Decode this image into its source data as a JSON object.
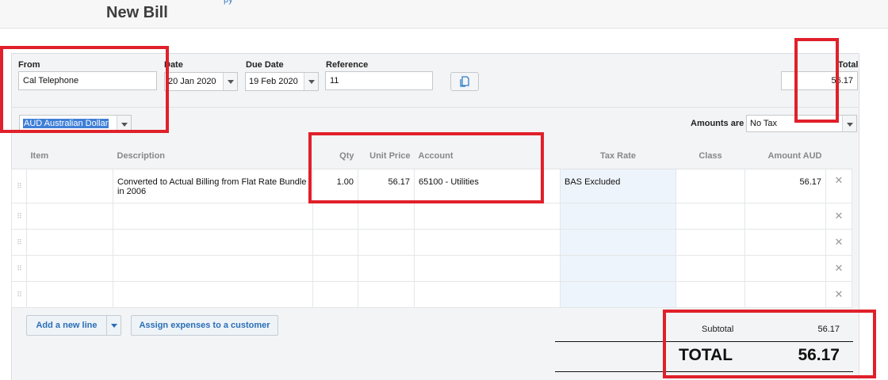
{
  "header": {
    "title": "New Bill",
    "top_link": "py"
  },
  "form": {
    "from_label": "From",
    "from_value": "Cal Telephone",
    "date_label": "Date",
    "date_value": "20 Jan 2020",
    "due_label": "Due Date",
    "due_value": "19 Feb 2020",
    "reference_label": "Reference",
    "reference_value": "11",
    "total_label": "Total",
    "total_value": "56.17",
    "currency_value": "AUD Australian Dollar",
    "amounts_are_label": "Amounts are",
    "amounts_are_value": "No Tax"
  },
  "table": {
    "headers": {
      "item": "Item",
      "description": "Description",
      "qty": "Qty",
      "unit_price": "Unit Price",
      "account": "Account",
      "tax_rate": "Tax Rate",
      "class": "Class",
      "amount": "Amount AUD"
    },
    "rows": [
      {
        "item": "",
        "description": "Converted to Actual Billing from Flat Rate Bundle in 2006",
        "qty": "1.00",
        "unit_price": "56.17",
        "account": "65100 - Utilities",
        "tax_rate": "BAS Excluded",
        "class": "",
        "amount": "56.17"
      }
    ],
    "drag_glyph": "⠿",
    "delete_glyph": "✕"
  },
  "actions": {
    "add_line": "Add a new line",
    "assign_expenses": "Assign expenses to a customer"
  },
  "summary": {
    "subtotal_label": "Subtotal",
    "subtotal_value": "56.17",
    "total_label": "TOTAL",
    "total_value": "56.17"
  },
  "colors": {
    "annotation": "#e0202a",
    "link": "#2a6fb7",
    "selection": "#3f7fd6"
  },
  "icons": {
    "copy_button": "copy-icon",
    "dropdown": "chevron-down-icon",
    "drag": "drag-handle-icon",
    "delete": "close-icon"
  }
}
